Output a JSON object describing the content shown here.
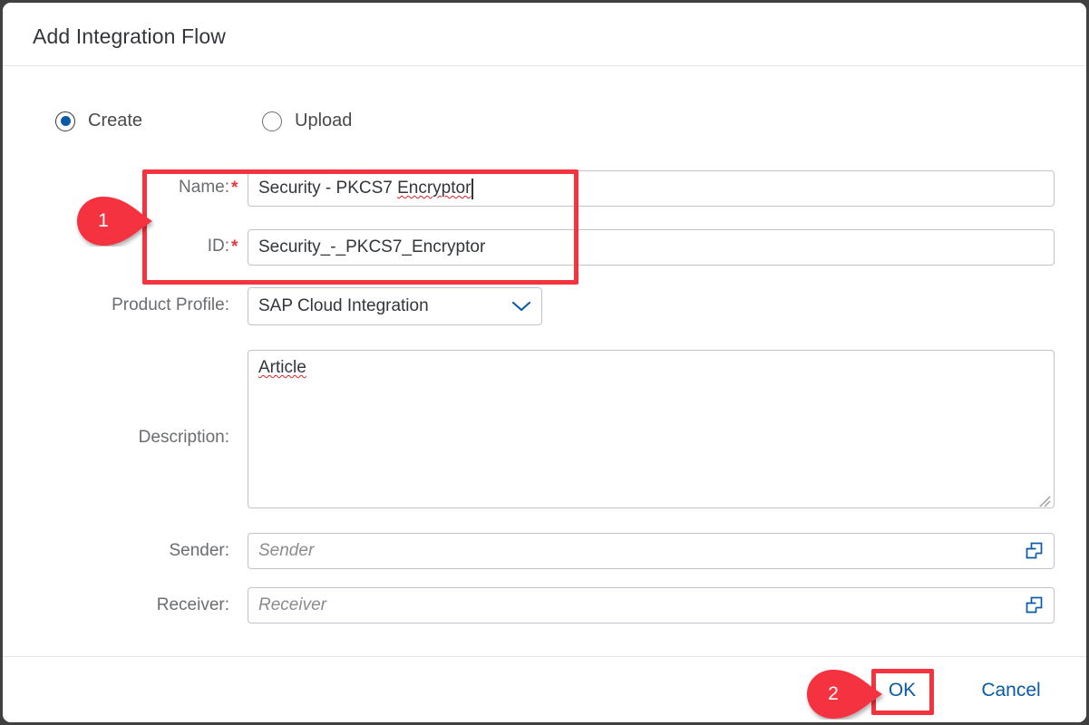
{
  "dialog": {
    "title": "Add Integration Flow"
  },
  "mode": {
    "create": {
      "label": "Create",
      "selected": true
    },
    "upload": {
      "label": "Upload",
      "selected": false
    }
  },
  "form": {
    "name": {
      "label": "Name:",
      "required_marker": "*",
      "value": "Security - PKCS7 Encryptor"
    },
    "id": {
      "label": "ID:",
      "required_marker": "*",
      "value": "Security_-_PKCS7_Encryptor"
    },
    "product_profile": {
      "label": "Product Profile:",
      "value": "SAP Cloud Integration",
      "icon": "chevron-down-icon"
    },
    "description": {
      "label": "Description:",
      "value": "Article"
    },
    "sender": {
      "label": "Sender:",
      "value": "",
      "placeholder": "Sender",
      "icon": "value-help-icon"
    },
    "receiver": {
      "label": "Receiver:",
      "value": "",
      "placeholder": "Receiver",
      "icon": "value-help-icon"
    }
  },
  "footer": {
    "ok_label": "OK",
    "cancel_label": "Cancel"
  },
  "annotations": {
    "callouts": [
      {
        "number": "1",
        "target": "name-and-id-fields"
      },
      {
        "number": "2",
        "target": "ok-button"
      }
    ]
  },
  "colors": {
    "accent": "#0a5aa8",
    "required": "#e4383a",
    "annotation": "#f5333f",
    "label_text": "#6a6d70",
    "value_text": "#32363a",
    "border": "#bfc4c9",
    "window_border": "#404040"
  }
}
